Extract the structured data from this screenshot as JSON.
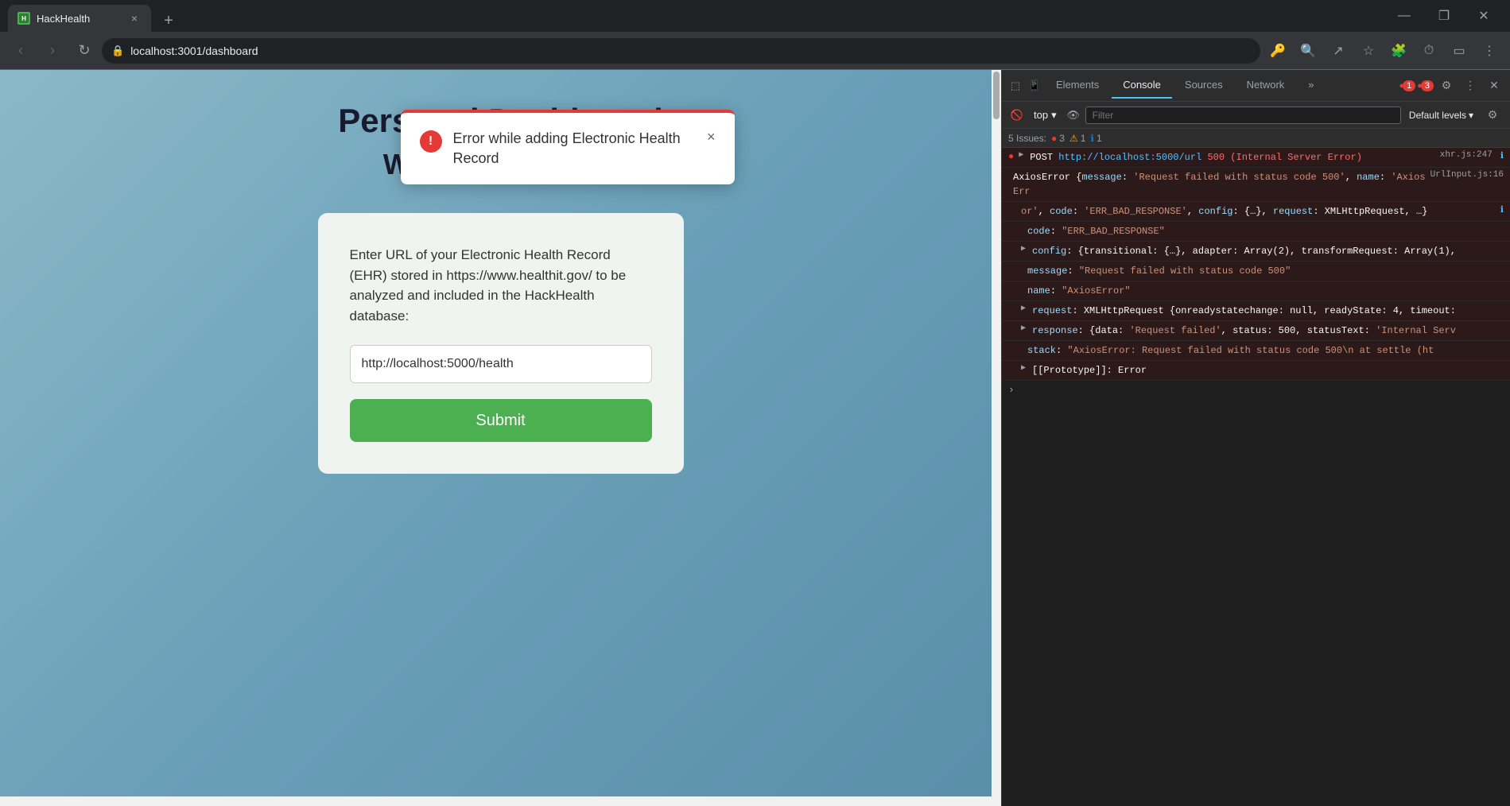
{
  "browser": {
    "tab_title": "HackHealth",
    "tab_url": "localhost:3001/dashboard",
    "new_tab_symbol": "+",
    "back_disabled": false,
    "forward_disabled": true,
    "address": "localhost:3001/dashboard"
  },
  "error_toast": {
    "title": "Error while adding Electronic Health Record",
    "close_symbol": "×"
  },
  "dashboard": {
    "title": "Personal Dashboard",
    "subtitle": "Welcome Samuel",
    "ehr_description": "Enter URL of your Electronic Health Record (EHR) stored in https://www.healthit.gov/ to be analyzed and included in the HackHealth database:",
    "url_input_value": "http://localhost:5000/health",
    "url_input_placeholder": "http://localhost:5000/health",
    "submit_label": "Submit"
  },
  "devtools": {
    "tabs": [
      "Elements",
      "Console",
      "Sources",
      "Network"
    ],
    "active_tab": "Console",
    "more_symbol": "»",
    "error_count_1": "1",
    "error_count_2": "3",
    "context": "top",
    "filter_placeholder": "Filter",
    "level": "Default levels",
    "issues_label": "5 Issues:",
    "issues_errors": "3",
    "issues_warnings": "1",
    "issues_info": "1",
    "console_lines": [
      {
        "type": "error",
        "prefix": "●",
        "arrow": "▶",
        "text": "POST http://localhost:5000/url 500 (Internal Server Error)",
        "link": "xhr.js:247"
      },
      {
        "type": "error_detail",
        "text": "AxiosError {message: 'Request failed with status code 500', name: 'AxiosError', code: 'ERR_BAD_RESPONSE', config: {…}, request: XMLHttpRequest, …}",
        "link": "UrlInput.js:16"
      },
      {
        "type": "property",
        "indent": true,
        "text": "code: \"ERR_BAD_RESPONSE\""
      },
      {
        "type": "property",
        "indent": true,
        "text": "config: {transitional: {…}, adapter: Array(2), transformRequest: Array(1),"
      },
      {
        "type": "property",
        "indent": true,
        "text": "message: \"Request failed with status code 500\""
      },
      {
        "type": "property",
        "indent": true,
        "text": "name: \"AxiosError\""
      },
      {
        "type": "property",
        "indent": true,
        "text": "request: XMLHttpRequest {onreadystatechange: null, readyState: 4, timeout:"
      },
      {
        "type": "property",
        "indent": true,
        "text": "response: {data: 'Request failed', status: 500, statusText: 'Internal Serv"
      },
      {
        "type": "property",
        "indent": true,
        "text": "stack: \"AxiosError: Request failed with status code 500\\n    at settle (ht"
      },
      {
        "type": "property",
        "indent": true,
        "text": "[[Prototype]]: Error"
      }
    ]
  }
}
